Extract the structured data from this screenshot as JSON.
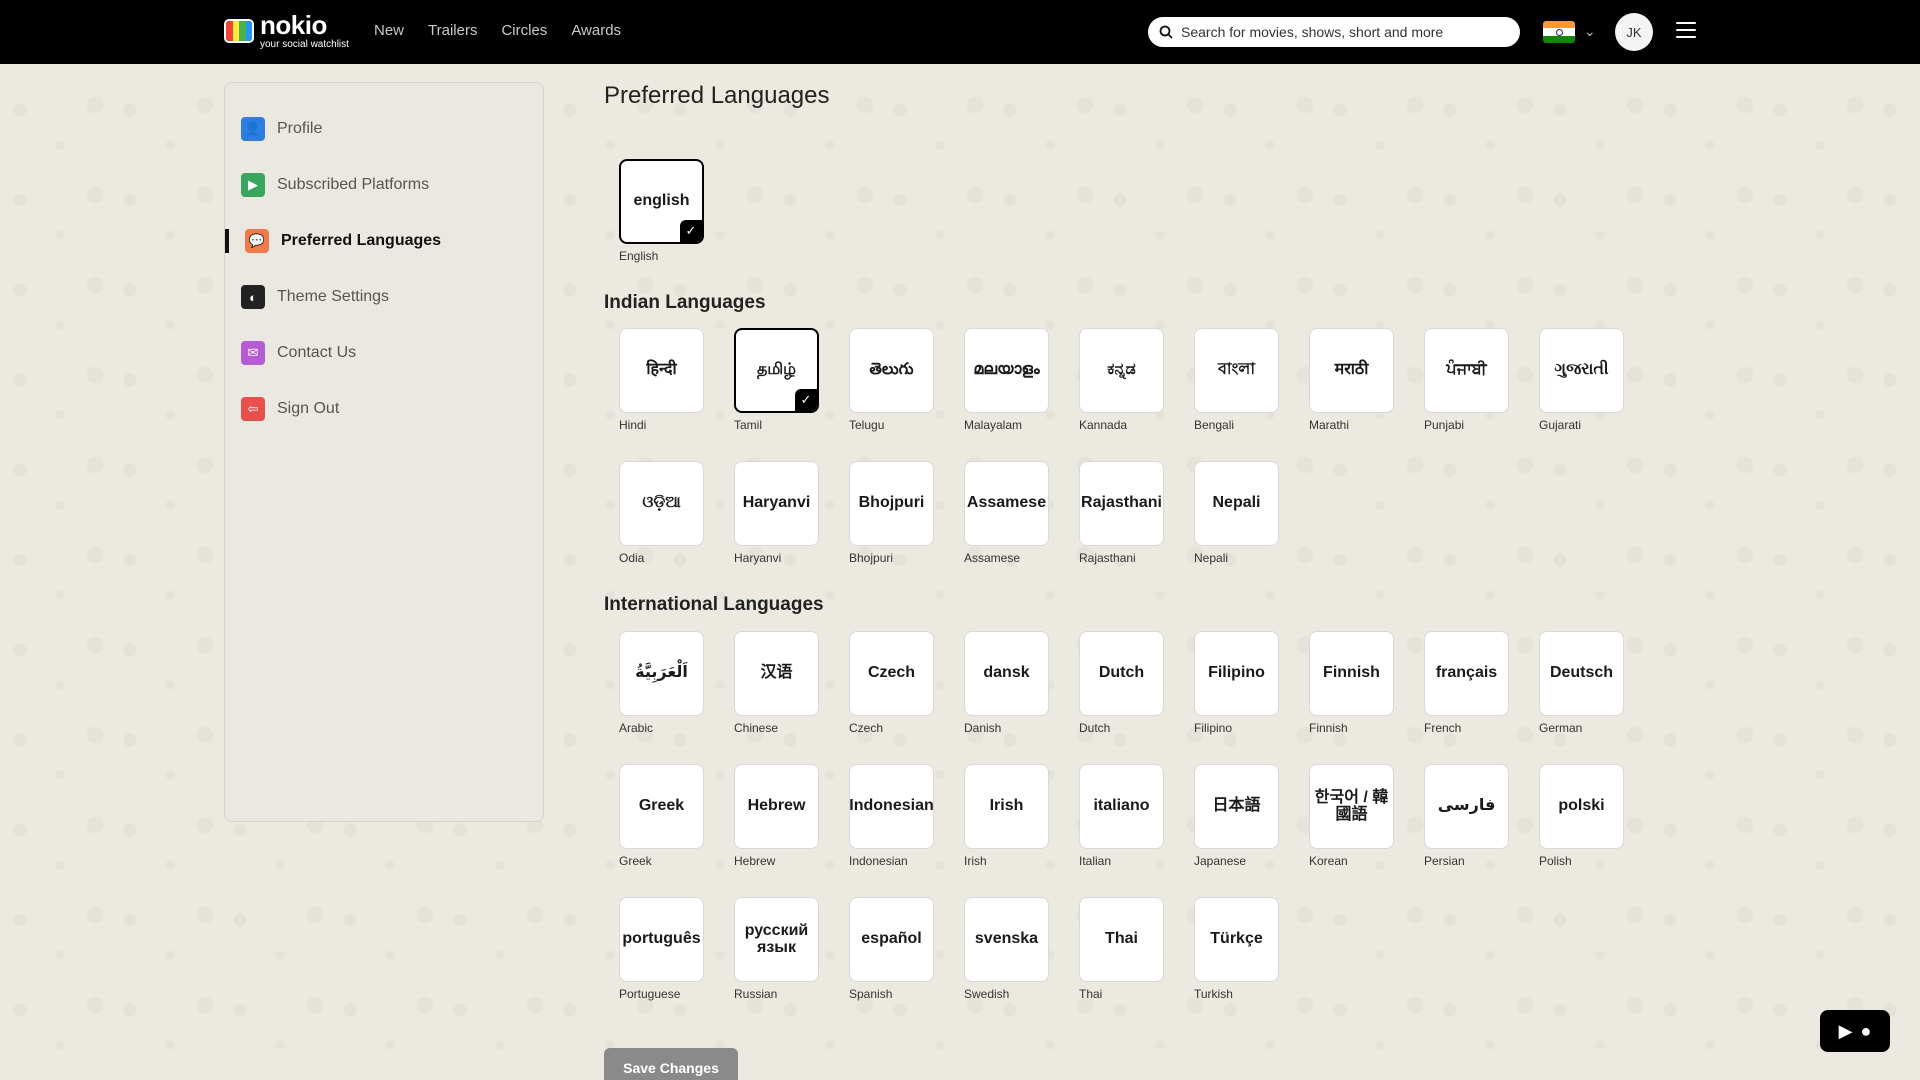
{
  "brand": {
    "name": "nokio",
    "tagline": "your social watchlist"
  },
  "nav": [
    "New",
    "Trailers",
    "Circles",
    "Awards"
  ],
  "search": {
    "placeholder": "Search for movies, shows, short and more"
  },
  "user": {
    "initials": "JK"
  },
  "sidebar": {
    "items": [
      {
        "label": "Profile",
        "icon": "person-icon",
        "color": "#2f7de1",
        "glyph": "👤"
      },
      {
        "label": "Subscribed Platforms",
        "icon": "tv-icon",
        "color": "#3aa55d",
        "glyph": "▶"
      },
      {
        "label": "Preferred Languages",
        "icon": "chat-icon",
        "color": "#f07a4a",
        "glyph": "💬",
        "active": true
      },
      {
        "label": "Theme Settings",
        "icon": "theme-icon",
        "color": "#222222",
        "glyph": "◐"
      },
      {
        "label": "Contact Us",
        "icon": "message-icon",
        "color": "#b55bd6",
        "glyph": "✉"
      },
      {
        "label": "Sign Out",
        "icon": "logout-icon",
        "color": "#e8504c",
        "glyph": "⇦"
      }
    ]
  },
  "main": {
    "title": "Preferred Languages",
    "default_lang": [
      {
        "tile": "english",
        "name": "English",
        "selected": true
      }
    ],
    "indian_title": "Indian Languages",
    "indian": [
      {
        "tile": "हिन्दी",
        "name": "Hindi"
      },
      {
        "tile": "தமிழ்",
        "name": "Tamil",
        "selected": true
      },
      {
        "tile": "తెలుగు",
        "name": "Telugu"
      },
      {
        "tile": "മലയാളം",
        "name": "Malayalam"
      },
      {
        "tile": "ಕನ್ನಡ",
        "name": "Kannada"
      },
      {
        "tile": "বাংলা",
        "name": "Bengali"
      },
      {
        "tile": "मराठी",
        "name": "Marathi"
      },
      {
        "tile": "ਪੰਜਾਬੀ",
        "name": "Punjabi"
      },
      {
        "tile": "ગુજરાતી",
        "name": "Gujarati"
      },
      {
        "tile": "ଓଡ଼ିଆ",
        "name": "Odia"
      },
      {
        "tile": "Haryanvi",
        "name": "Haryanvi"
      },
      {
        "tile": "Bhojpuri",
        "name": "Bhojpuri"
      },
      {
        "tile": "Assamese",
        "name": "Assamese"
      },
      {
        "tile": "Rajasthani",
        "name": "Rajasthani"
      },
      {
        "tile": "Nepali",
        "name": "Nepali"
      }
    ],
    "intl_title": "International Languages",
    "international": [
      {
        "tile": "اَلْعَرَبِيَّةُ",
        "name": "Arabic"
      },
      {
        "tile": "汉语",
        "name": "Chinese"
      },
      {
        "tile": "Czech",
        "name": "Czech"
      },
      {
        "tile": "dansk",
        "name": "Danish"
      },
      {
        "tile": "Dutch",
        "name": "Dutch"
      },
      {
        "tile": "Filipino",
        "name": "Filipino"
      },
      {
        "tile": "Finnish",
        "name": "Finnish"
      },
      {
        "tile": "français",
        "name": "French"
      },
      {
        "tile": "Deutsch",
        "name": "German"
      },
      {
        "tile": "Greek",
        "name": "Greek"
      },
      {
        "tile": "Hebrew",
        "name": "Hebrew"
      },
      {
        "tile": "Indonesian",
        "name": "Indonesian"
      },
      {
        "tile": "Irish",
        "name": "Irish"
      },
      {
        "tile": "italiano",
        "name": "Italian"
      },
      {
        "tile": "日本語",
        "name": "Japanese"
      },
      {
        "tile": "한국어 / 韓國語",
        "name": "Korean"
      },
      {
        "tile": "فارسی",
        "name": "Persian"
      },
      {
        "tile": "polski",
        "name": "Polish"
      },
      {
        "tile": "português",
        "name": "Portuguese"
      },
      {
        "tile": "русский язык",
        "name": "Russian"
      },
      {
        "tile": "español",
        "name": "Spanish"
      },
      {
        "tile": "svenska",
        "name": "Swedish"
      },
      {
        "tile": "Thai",
        "name": "Thai"
      },
      {
        "tile": "Türkçe",
        "name": "Turkish"
      }
    ],
    "save_label": "Save Changes"
  }
}
